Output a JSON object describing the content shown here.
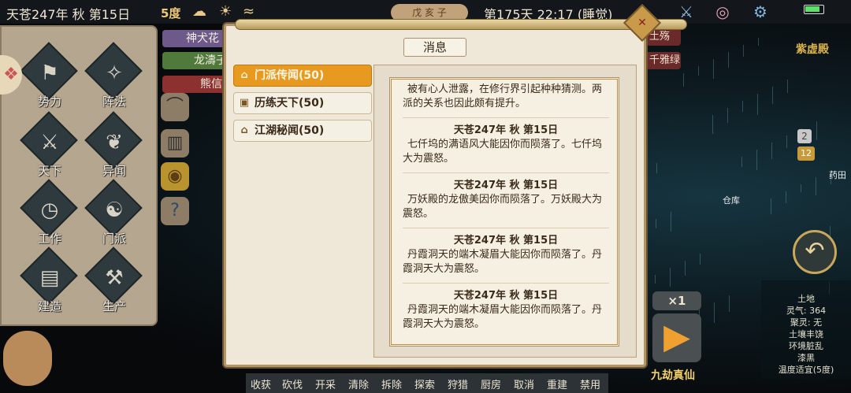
{
  "topbar": {
    "date": "天苍247年 秋 第15日",
    "temperature": "5度",
    "ganzhi": "戊 亥 子",
    "daycount": "第175天  22:17 (睡觉)",
    "icons": [
      "cloud-icon",
      "sun-icon",
      "wind-icon",
      "crossed-swords-icon",
      "palette-icon",
      "gear-icon"
    ],
    "battery_level": 0.8
  },
  "left_panel": {
    "skills": [
      {
        "label": "势力",
        "icon": "faction-icon"
      },
      {
        "label": "阵法",
        "icon": "formation-icon"
      },
      {
        "label": "天下",
        "icon": "world-icon"
      },
      {
        "label": "异闻",
        "icon": "rumor-icon"
      },
      {
        "label": "工作",
        "icon": "work-icon"
      },
      {
        "label": "门派",
        "icon": "sect-icon"
      },
      {
        "label": "建造",
        "icon": "build-icon"
      },
      {
        "label": "生产",
        "icon": "produce-icon"
      }
    ]
  },
  "name_chips": {
    "left": [
      "神犬花",
      "龙濤子",
      "熊信"
    ],
    "right": [
      "土殇",
      "千雅绿"
    ]
  },
  "dialog": {
    "title": "消息",
    "tabs": [
      {
        "label": "门派传闻(50)",
        "active": true,
        "icon": "temple-icon"
      },
      {
        "label": "历练天下(50)",
        "active": false,
        "icon": "scroll-icon"
      },
      {
        "label": "江湖秘闻(50)",
        "active": false,
        "icon": "pavilion-icon"
      }
    ],
    "messages": [
      {
        "date": "",
        "text": "被有心人泄露，在修行界引起种种猜测。两派的关系也因此颇有提升。"
      },
      {
        "date": "天苍247年 秋 第15日",
        "text": "七仟坞的满语风大能因你而陨落了。七仟坞大为震怒。"
      },
      {
        "date": "天苍247年 秋 第15日",
        "text": "万妖殿的龙傲美因你而陨落了。万妖殿大为震怒。"
      },
      {
        "date": "天苍247年 秋 第15日",
        "text": "丹霞洞天的端木凝眉大能因你而陨落了。丹霞洞天大为震怒。"
      },
      {
        "date": "天苍247年 秋 第15日",
        "text": "丹霞洞天的端木凝眉大能因你而陨落了。丹霞洞天大为震怒。"
      }
    ]
  },
  "right": {
    "place_name": "紫虚殿",
    "herb_field": "药田",
    "warehouse": "仓库",
    "badge_a": "2",
    "badge_b": "12",
    "info": [
      "土地",
      "灵气: 364",
      "聚灵: 无",
      "土壤丰饶",
      "环境脏乱",
      "漆黑",
      "温度适宜(5度)"
    ]
  },
  "controls": {
    "speed": "×1",
    "stage": "九劫真仙"
  },
  "bottom_actions": [
    "收获",
    "砍伐",
    "开采",
    "清除",
    "拆除",
    "探索",
    "狩猎",
    "厨房",
    "取消",
    "重建",
    "禁用"
  ]
}
